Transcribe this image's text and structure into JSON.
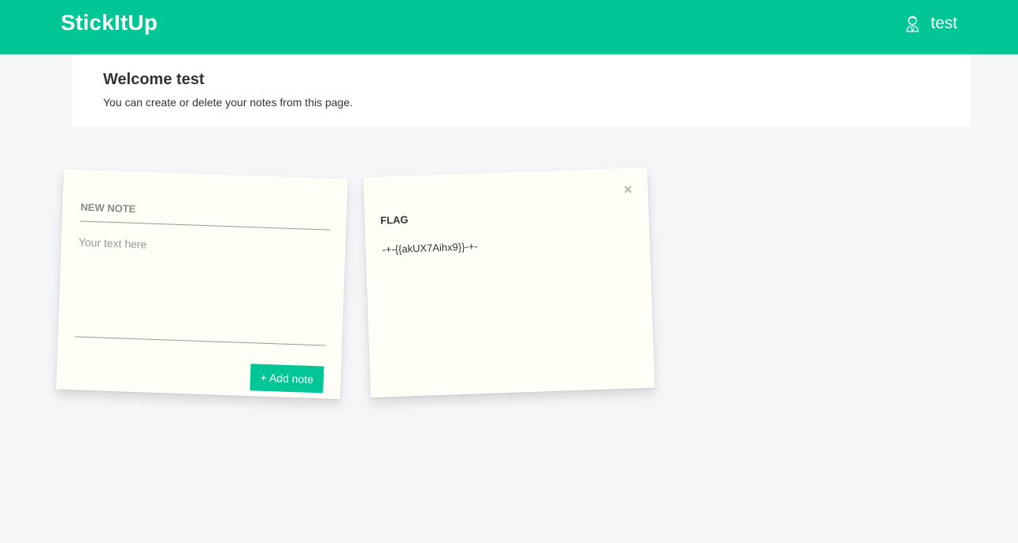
{
  "header": {
    "brand": "StickItUp",
    "username": "test"
  },
  "welcome": {
    "title": "Welcome test",
    "subtitle": "You can create or delete your notes from this page."
  },
  "new_note": {
    "title_placeholder": "NEW NOTE",
    "text_placeholder": "Your text here",
    "add_button_label": "+ Add note"
  },
  "notes": [
    {
      "title": "FLAG",
      "text": "-+-{{akUX7Aihx9}}-+-",
      "close_label": "×"
    }
  ],
  "colors": {
    "accent": "#00c595",
    "note_background": "#fefef6",
    "page_background": "#f5f6f8"
  }
}
